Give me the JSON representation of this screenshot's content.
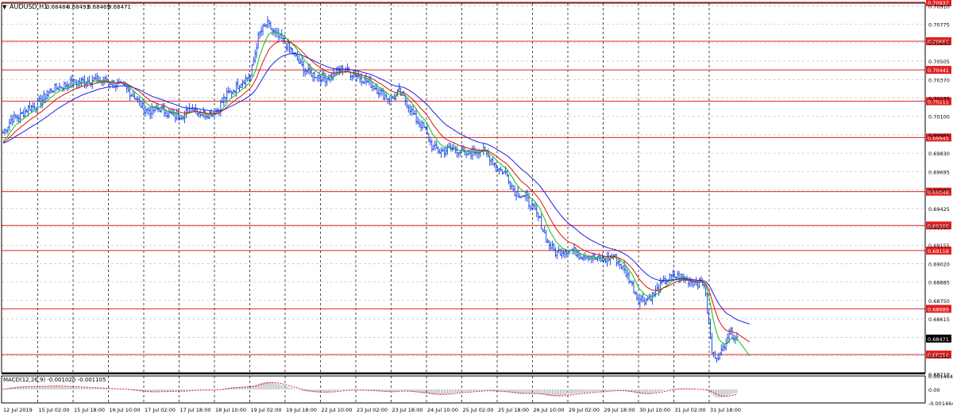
{
  "header": {
    "menu_icon": "triangle-down-icon",
    "symbol_timeframe": "AUDUSD,H1",
    "ohlc": [
      "0.68484",
      "0.68493",
      "0.68469",
      "0.68471"
    ]
  },
  "colors": {
    "background": "#ffffff",
    "grid": "#c8c8c8",
    "price_line": "#2050e0",
    "ma_fast": "#10c010",
    "ma_mid": "#e01010",
    "ma_slow": "#2020e0",
    "level_line": "#e02020",
    "level_tag": "#e02020",
    "current_tag": "#000000",
    "macd": "#e02020"
  },
  "macd": {
    "label": "MACD(12,26,9) -0.001020 -0.001105",
    "ticks": [
      "0.001464",
      "0.00",
      "-0.001464"
    ],
    "ylim": [
      -0.001464,
      0.001464
    ]
  },
  "chart_data": {
    "type": "line",
    "title": "",
    "xlabel": "",
    "ylabel": "",
    "ylim": [
      0.6822,
      0.7093
    ],
    "x_ticks": [
      "12 Jul 2019",
      "15 Jul 02:00",
      "15 Jul 18:00",
      "16 Jul 10:00",
      "17 Jul 02:00",
      "17 Jul 18:00",
      "18 Jul 10:00",
      "19 Jul 02:00",
      "19 Jul 18:00",
      "22 Jul 10:00",
      "23 Jul 02:00",
      "23 Jul 18:00",
      "24 Jul 10:00",
      "25 Jul 02:00",
      "25 Jul 18:00",
      "26 Jul 10:00",
      "29 Jul 02:00",
      "29 Jul 18:00",
      "30 Jul 10:00",
      "31 Jul 02:00",
      "31 Jul 18:00"
    ],
    "y_ticks": [
      "0.70910",
      "0.70775",
      "0.70640",
      "0.70505",
      "0.70370",
      "0.70235",
      "0.70100",
      "0.69965",
      "0.69830",
      "0.69695",
      "0.69560",
      "0.69425",
      "0.69290",
      "0.69155",
      "0.69020",
      "0.68885",
      "0.68750",
      "0.68615",
      "0.68480",
      "0.68345",
      "0.68210"
    ],
    "levels": [
      "0.70937",
      "0.70651",
      "0.70441",
      "0.70211",
      "0.69945",
      "0.69548",
      "0.69300",
      "0.69116",
      "0.68689",
      "0.68354"
    ],
    "current_price": "0.68471",
    "series": [
      {
        "values": [
          0.6998,
          0.7008,
          0.701,
          0.7016,
          0.7018,
          0.7024,
          0.703,
          0.7032,
          0.7034,
          0.7035,
          0.7036,
          0.7037,
          0.7036,
          0.7035,
          0.7033,
          0.703,
          0.7024,
          0.7016,
          0.7014,
          0.7016,
          0.7012,
          0.701,
          0.7012,
          0.7017,
          0.7012,
          0.7012,
          0.7015,
          0.7025,
          0.703,
          0.7036,
          0.704,
          0.707,
          0.7078,
          0.707,
          0.7065,
          0.7058,
          0.7048,
          0.7042,
          0.704,
          0.7038,
          0.704,
          0.7045,
          0.7042,
          0.704,
          0.7036,
          0.7032,
          0.7026,
          0.7022,
          0.7028,
          0.702,
          0.7008,
          0.7002,
          0.6988,
          0.6984,
          0.6986,
          0.6986,
          0.6982,
          0.6984,
          0.6986,
          0.698,
          0.6972,
          0.6968,
          0.6955,
          0.6952,
          0.6945,
          0.6935,
          0.6918,
          0.691,
          0.6912,
          0.6912,
          0.6908,
          0.6908,
          0.6905,
          0.6905,
          0.6908,
          0.69,
          0.689,
          0.6876,
          0.6876,
          0.688,
          0.6888,
          0.6892,
          0.6893,
          0.689,
          0.6888,
          0.6888,
          0.6835,
          0.6835,
          0.6852,
          0.6848
        ]
      }
    ]
  }
}
